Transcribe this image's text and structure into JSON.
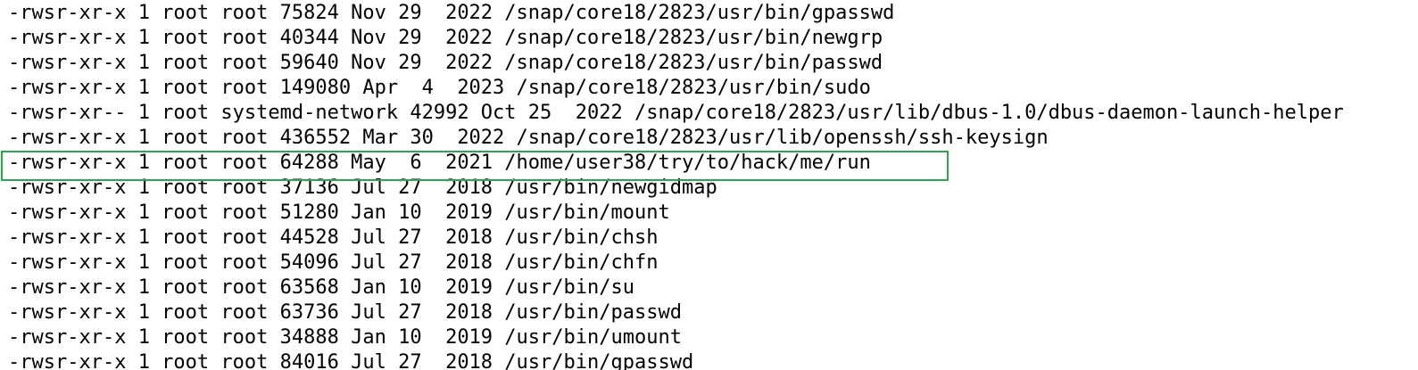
{
  "terminal": {
    "lines": [
      "-rwsr-xr-x 1 root root 75824 Nov 29  2022 /snap/core18/2823/usr/bin/gpasswd",
      "-rwsr-xr-x 1 root root 40344 Nov 29  2022 /snap/core18/2823/usr/bin/newgrp",
      "-rwsr-xr-x 1 root root 59640 Nov 29  2022 /snap/core18/2823/usr/bin/passwd",
      "-rwsr-xr-x 1 root root 149080 Apr  4  2023 /snap/core18/2823/usr/bin/sudo",
      "-rwsr-xr-- 1 root systemd-network 42992 Oct 25  2022 /snap/core18/2823/usr/lib/dbus-1.0/dbus-daemon-launch-helper",
      "-rwsr-xr-x 1 root root 436552 Mar 30  2022 /snap/core18/2823/usr/lib/openssh/ssh-keysign",
      "-rwsr-xr-x 1 root root 64288 May  6  2021 /home/user38/try/to/hack/me/run",
      "-rwsr-xr-x 1 root root 37136 Jul 27  2018 /usr/bin/newgidmap",
      "-rwsr-xr-x 1 root root 51280 Jan 10  2019 /usr/bin/mount",
      "-rwsr-xr-x 1 root root 44528 Jul 27  2018 /usr/bin/chsh",
      "-rwsr-xr-x 1 root root 54096 Jul 27  2018 /usr/bin/chfn",
      "-rwsr-xr-x 1 root root 63568 Jan 10  2019 /usr/bin/su",
      "-rwsr-xr-x 1 root root 63736 Jul 27  2018 /usr/bin/passwd",
      "-rwsr-xr-x 1 root root 34888 Jan 10  2019 /usr/bin/umount",
      "-rwsr-xr-x 1 root root 84016 Jul 27  2018 /usr/bin/gpasswd"
    ]
  },
  "highlight": {
    "line_index": 6,
    "color": "#2aa84a"
  }
}
